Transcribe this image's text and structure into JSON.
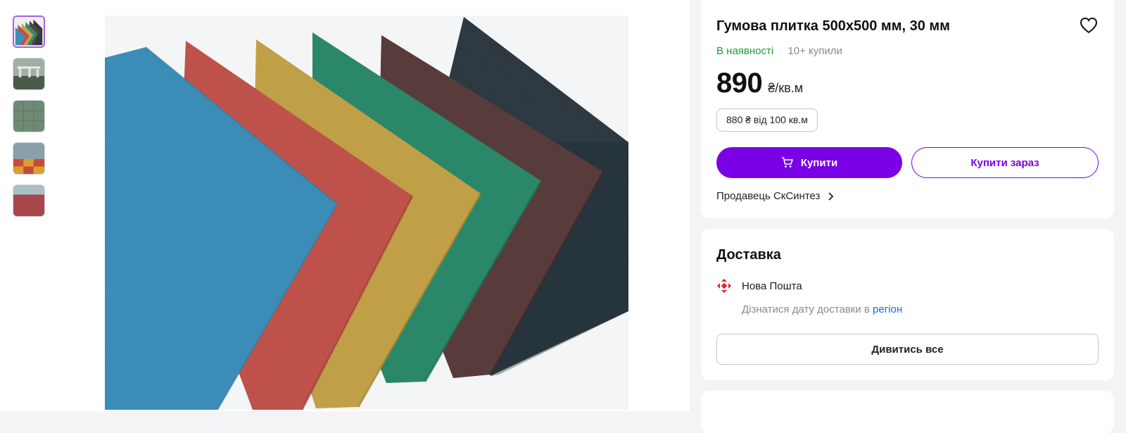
{
  "product": {
    "title": "Гумова плитка 500х500 мм, 30 мм",
    "in_stock": "В наявності",
    "bought": "10+ купили",
    "price": "890",
    "price_unit": "₴/кв.м",
    "tier_price": "880 ₴ від 100 кв.м",
    "buy_label": "Купити",
    "buy_now_label": "Купити зараз",
    "seller_label": "Продавець СкСинтез"
  },
  "delivery": {
    "title": "Доставка",
    "carrier": "Нова Пошта",
    "hint_prefix": "Дізнатися дату доставки в",
    "hint_link": "регіон",
    "view_all_label": "Дивитись все"
  },
  "gallery": {
    "thumbnails": [
      "thumb-colored-tiles",
      "thumb-playground",
      "thumb-green-floor",
      "thumb-mixed-floor",
      "thumb-red-floor"
    ],
    "tile_colors": [
      "#2f3a40",
      "#5a3d3a",
      "#2f8a6e",
      "#c2a24a",
      "#c0504a",
      "#3d8fb8"
    ]
  },
  "colors": {
    "accent": "#7a00e6",
    "in_stock": "#1f9a3a",
    "link": "#1a6ad6"
  }
}
